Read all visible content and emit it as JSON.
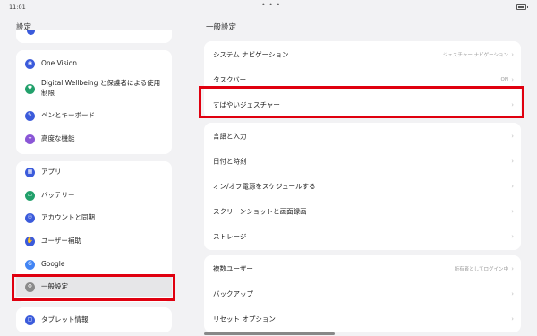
{
  "status": {
    "time": "11:01",
    "dots": "• • •"
  },
  "left_title": "設定",
  "right_title": "一般設定",
  "left_group1": [
    {
      "label": "One Vision",
      "icon": "one-vision-icon",
      "glyph": "◉",
      "color": "#3b5bdb"
    },
    {
      "label": "Digital Wellbeing と保護者による使用\n制限",
      "icon": "digital-wellbeing-icon",
      "glyph": "♥",
      "color": "#22a06b"
    },
    {
      "label": "ペンとキーボード",
      "icon": "pen-keyboard-icon",
      "glyph": "✎",
      "color": "#3b5bdb"
    },
    {
      "label": "高度な機能",
      "icon": "advanced-features-icon",
      "glyph": "✦",
      "color": "#8a56d6"
    }
  ],
  "left_group2": [
    {
      "label": "アプリ",
      "icon": "apps-icon",
      "glyph": "▦",
      "color": "#3b5bdb"
    },
    {
      "label": "バッテリー",
      "icon": "battery-icon",
      "glyph": "▭",
      "color": "#22a06b"
    },
    {
      "label": "アカウントと同期",
      "icon": "accounts-icon",
      "glyph": "⚇",
      "color": "#3b5bdb"
    },
    {
      "label": "ユーザー補助",
      "icon": "accessibility-icon",
      "glyph": "✋",
      "color": "#3b5bdb"
    },
    {
      "label": "Google",
      "icon": "google-icon",
      "glyph": "G",
      "color": "#4285f4"
    },
    {
      "label": "一般設定",
      "icon": "general-settings-icon",
      "glyph": "⚙",
      "color": "#8a8a8a"
    }
  ],
  "left_group3": [
    {
      "label": "タブレット情報",
      "icon": "tablet-info-icon",
      "glyph": "▢",
      "color": "#3b5bdb"
    }
  ],
  "right_group1": [
    {
      "label": "システム ナビゲーション",
      "value": "ジェスチャー ナビゲーション"
    },
    {
      "label": "タスクバー",
      "value": "ON"
    },
    {
      "label": "すばやいジェスチャー",
      "value": ""
    }
  ],
  "right_group2": [
    {
      "label": "言語と入力",
      "value": ""
    },
    {
      "label": "日付と時刻",
      "value": ""
    },
    {
      "label": "オン/オフ電源をスケジュールする",
      "value": ""
    },
    {
      "label": "スクリーンショットと画面録画",
      "value": ""
    },
    {
      "label": "ストレージ",
      "value": ""
    }
  ],
  "right_group3": [
    {
      "label": "複数ユーザー",
      "value": "所有者としてログイン中"
    },
    {
      "label": "バックアップ",
      "value": ""
    },
    {
      "label": "リセット オプション",
      "value": ""
    }
  ],
  "colors": {
    "highlight": "#e0000f",
    "background": "#f2f2f4",
    "card": "#ffffff"
  }
}
